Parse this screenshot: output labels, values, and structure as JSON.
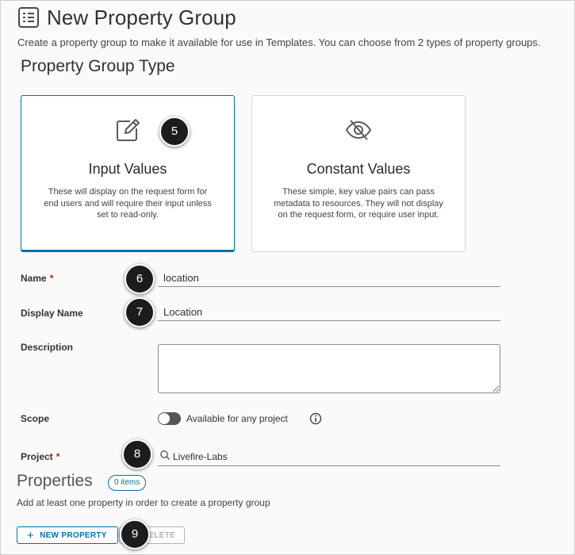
{
  "page": {
    "title": "New Property Group",
    "intro": "Create a property group to make it available for use in Templates. You can choose from 2 types of property groups.",
    "section_title": "Property Group Type",
    "page_icon": "list-icon"
  },
  "type_cards": [
    {
      "title": "Input Values",
      "description": "These will display on the request form for end users and will require their input unless set to read-only.",
      "icon": "edit-icon",
      "selected": true
    },
    {
      "title": "Constant Values",
      "description": "These simple, key value pairs can pass metadata to resources. They will not display on the request form, or require user input.",
      "icon": "eye-hide-icon",
      "selected": false
    }
  ],
  "form": {
    "name_label": "Name",
    "name_value": "location",
    "display_name_label": "Display Name",
    "display_name_value": "Location",
    "description_label": "Description",
    "description_value": "",
    "scope_label": "Scope",
    "scope_toggle_label": "Available for any project",
    "scope_enabled": false,
    "project_label": "Project",
    "project_value": "Livefire-Labs",
    "required_marker": "*"
  },
  "properties": {
    "title": "Properties",
    "count_badge": "0 items",
    "description": "Add at least one property in order to create a property group",
    "new_button": "NEW PROPERTY",
    "new_button_icon": "+",
    "delete_button": "DELETE"
  },
  "step_markers": [
    "5",
    "6",
    "7",
    "8",
    "9"
  ],
  "colors": {
    "accent": "#0072a3",
    "required": "#c92100",
    "marker": "#1c1c1c"
  }
}
